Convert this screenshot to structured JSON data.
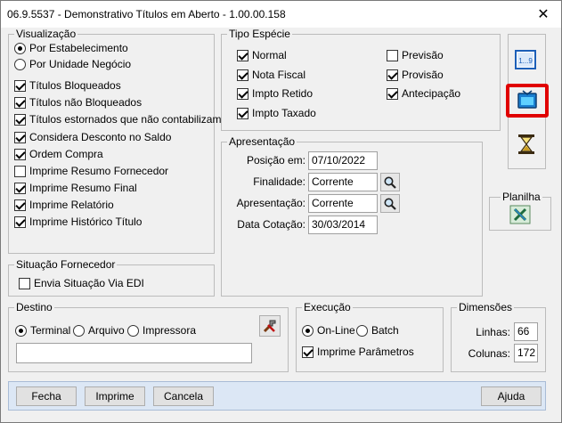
{
  "window": {
    "title": "06.9.5537 - Demonstrativo Títulos em Aberto - 1.00.00.158",
    "close_glyph": "✕"
  },
  "visualizacao": {
    "legend": "Visualização",
    "radios": [
      {
        "label": "Por Estabelecimento",
        "checked": true
      },
      {
        "label": "Por Unidade Negócio",
        "checked": false
      }
    ],
    "checks": [
      {
        "label": "Títulos Bloqueados",
        "checked": true
      },
      {
        "label": "Títulos não Bloqueados",
        "checked": true
      },
      {
        "label": "Títulos estornados que não contabilizam",
        "checked": true
      },
      {
        "label": "Considera Desconto no Saldo",
        "checked": true
      },
      {
        "label": "Ordem Compra",
        "checked": true
      },
      {
        "label": "Imprime Resumo Fornecedor",
        "checked": false
      },
      {
        "label": "Imprime Resumo Final",
        "checked": true
      },
      {
        "label": "Imprime Relatório",
        "checked": true
      },
      {
        "label": "Imprime Histórico Título",
        "checked": true
      }
    ]
  },
  "situacao": {
    "legend": "Situação Fornecedor",
    "check": {
      "label": "Envia Situação Via EDI",
      "checked": false
    }
  },
  "tipo_especie": {
    "legend": "Tipo Espécie",
    "left": [
      {
        "label": "Normal",
        "checked": true
      },
      {
        "label": "Nota Fiscal",
        "checked": true
      },
      {
        "label": "Impto Retido",
        "checked": true
      },
      {
        "label": "Impto Taxado",
        "checked": true
      }
    ],
    "right": [
      {
        "label": "Previsão",
        "checked": false
      },
      {
        "label": "Provisão",
        "checked": true
      },
      {
        "label": "Antecipação",
        "checked": true
      }
    ]
  },
  "apresentacao": {
    "legend": "Apresentação",
    "posicao_label": "Posição em:",
    "posicao_value": "07/10/2022",
    "finalidade_label": "Finalidade:",
    "finalidade_value": "Corrente",
    "apresentacao_label": "Apresentação:",
    "apresentacao_value": "Corrente",
    "data_cotacao_label": "Data Cotação:",
    "data_cotacao_value": "30/03/2014"
  },
  "toolbar": {
    "icons": [
      "range-icon",
      "screen-output-icon",
      "hourglass-icon"
    ]
  },
  "planilha": {
    "legend": "Planilha",
    "icon": "excel-icon"
  },
  "destino": {
    "legend": "Destino",
    "radios": [
      {
        "label": "Terminal",
        "checked": true
      },
      {
        "label": "Arquivo",
        "checked": false
      },
      {
        "label": "Impressora",
        "checked": false
      }
    ],
    "path_value": ""
  },
  "execucao": {
    "legend": "Execução",
    "radios": [
      {
        "label": "On-Line",
        "checked": true
      },
      {
        "label": "Batch",
        "checked": false
      }
    ],
    "check": {
      "label": "Imprime Parâmetros",
      "checked": true
    }
  },
  "dimensoes": {
    "legend": "Dimensões",
    "linhas_label": "Linhas:",
    "linhas_value": "66",
    "colunas_label": "Colunas:",
    "colunas_value": "172"
  },
  "buttons": {
    "fecha": "Fecha",
    "imprime": "Imprime",
    "cancela": "Cancela",
    "ajuda": "Ajuda"
  },
  "colors": {
    "highlight": "#e00000",
    "window_bg": "#f0f0f0",
    "border": "#bcbcbc"
  }
}
